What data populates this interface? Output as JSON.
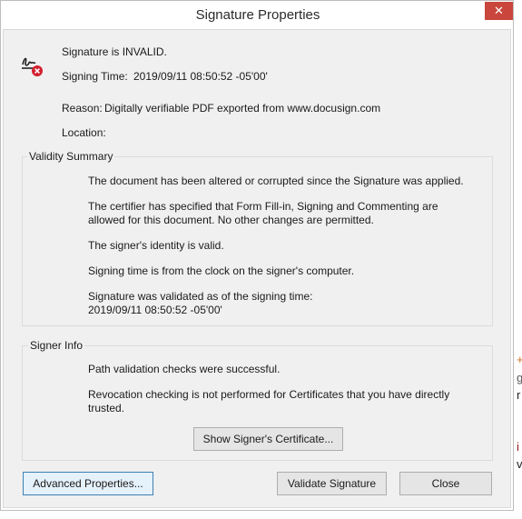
{
  "window": {
    "title": "Signature Properties",
    "close_glyph": "✕"
  },
  "header": {
    "icon": "signature-invalid-icon",
    "status": "Signature is INVALID.",
    "signing_time_label": "Signing Time:",
    "signing_time_value": "2019/09/11 08:50:52 -05'00'",
    "reason_label": "Reason:",
    "reason_value": "Digitally verifiable PDF exported from www.docusign.com",
    "location_label": "Location:",
    "location_value": ""
  },
  "validity_summary": {
    "title": "Validity Summary",
    "items": [
      "The document has been altered or corrupted since the Signature was applied.",
      "The certifier has specified that Form Fill-in, Signing and Commenting are",
      "allowed for this document. No other changes are permitted.",
      "The signer's identity is valid.",
      "Signing time is from the clock on the signer's computer.",
      "Signature was validated as of the signing time:",
      "2019/09/11 08:50:52 -05'00'"
    ]
  },
  "signer_info": {
    "title": "Signer Info",
    "items": [
      "Path validation checks were successful.",
      "Revocation checking is not performed for Certificates that you have directly",
      "trusted."
    ],
    "show_certificate_label": "Show Signer's Certificate..."
  },
  "footer": {
    "advanced_label": "Advanced Properties...",
    "validate_label": "Validate Signature",
    "close_label": "Close"
  },
  "background_edge": {
    "letters": [
      "+",
      "g",
      "r",
      "i",
      "v"
    ],
    "colors": {
      "orange": "#d0701e",
      "dark": "#222222",
      "red": "#8b1a1a"
    }
  }
}
